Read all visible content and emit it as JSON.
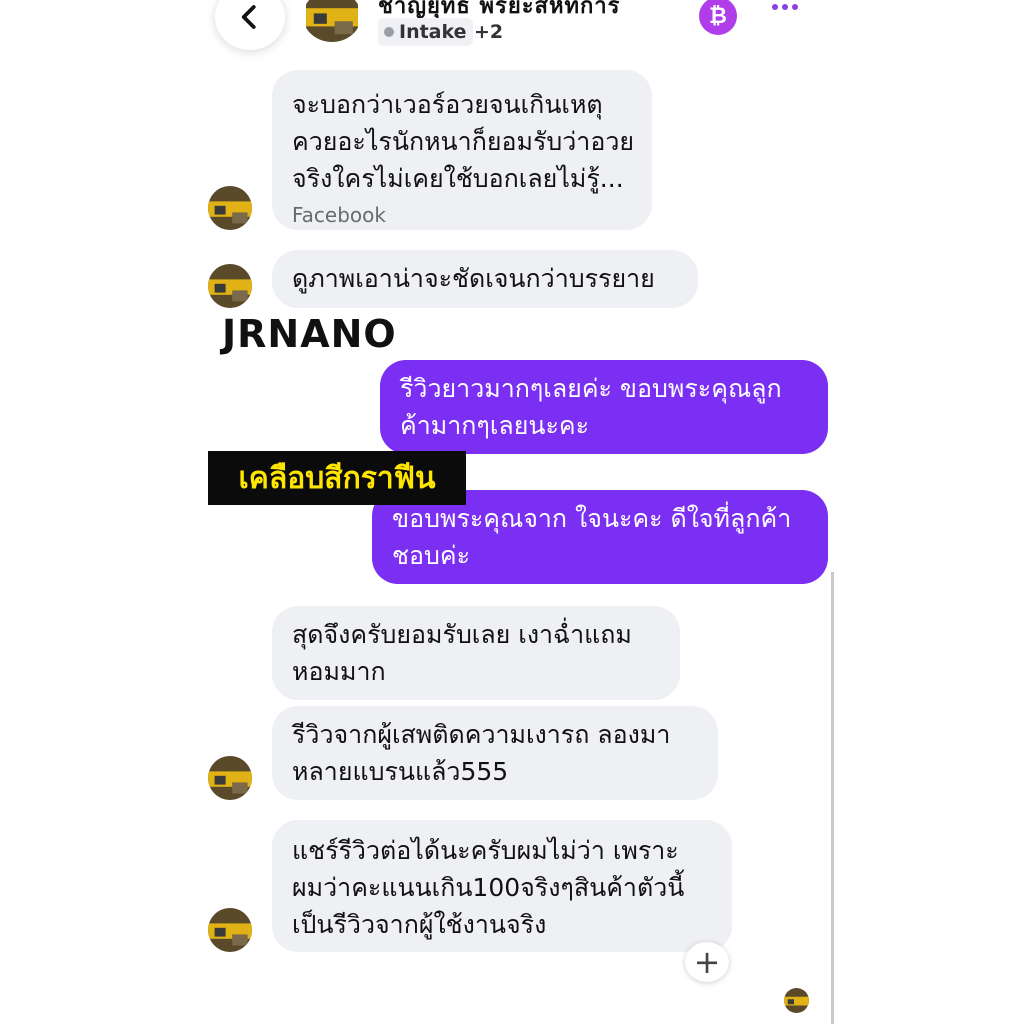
{
  "header": {
    "contact_name": "ชาญยุทธ พรยะสหัทการ",
    "tags": [
      "Intake",
      "+2"
    ],
    "icons": {
      "back": "chevron-left-icon",
      "currency": "bitcoin-icon",
      "more": "more-horizontal-icon"
    },
    "currency_symbol": "₿"
  },
  "messages": [
    {
      "direction": "incoming",
      "lines": [
        "จะบอกว่าเวอร์อวยจนเกินเหตุ",
        "ควยอะไรนักหนาก็ยอมรับว่าอวย",
        "จริงใครไม่เคยใช้บอกเลยไม่รู้..."
      ],
      "source": "Facebook"
    },
    {
      "direction": "incoming",
      "lines": [
        "ดูภาพเอาน่าจะชัดเจนกว่าบรรยาย"
      ]
    },
    {
      "direction": "outgoing",
      "lines": [
        "รีวิวยาวมากๆเลยค่ะ ขอบพระคุณลูก",
        "ค้ามากๆเลยนะคะ"
      ]
    },
    {
      "direction": "outgoing",
      "lines": [
        "ขอบพระคุณจาก ใจนะคะ ดีใจที่ลูกค้า",
        "ชอบค่ะ"
      ]
    },
    {
      "direction": "incoming",
      "lines": [
        "สุดจึงครับยอมรับเลย เงาฉ่ำแถม",
        "หอมมาก"
      ]
    },
    {
      "direction": "incoming",
      "lines": [
        "รีวิวจากผู้เสพติดความเงารถ ลองมา",
        "หลายแบรนแล้ว555"
      ]
    },
    {
      "direction": "incoming",
      "lines": [
        "แชร์รีวิวต่อได้นะครับผมไม่ว่า เพราะ",
        "ผมว่าคะแนนเกิน100จริงๆสินค้าตัวนี้",
        "เป็นรีวิวจากผู้ใช้งานจริง"
      ]
    }
  ],
  "overlays": {
    "brand": "JRNANO",
    "caption": "เคลือบสีกราฟีน"
  },
  "composer": {
    "add_icon": "plus-icon",
    "add_symbol": "+"
  },
  "colors": {
    "outgoing_bubble": "#7b2ff2",
    "incoming_bubble": "#eff0f3",
    "accent": "#b03dea",
    "caption_text": "#ffe600"
  }
}
